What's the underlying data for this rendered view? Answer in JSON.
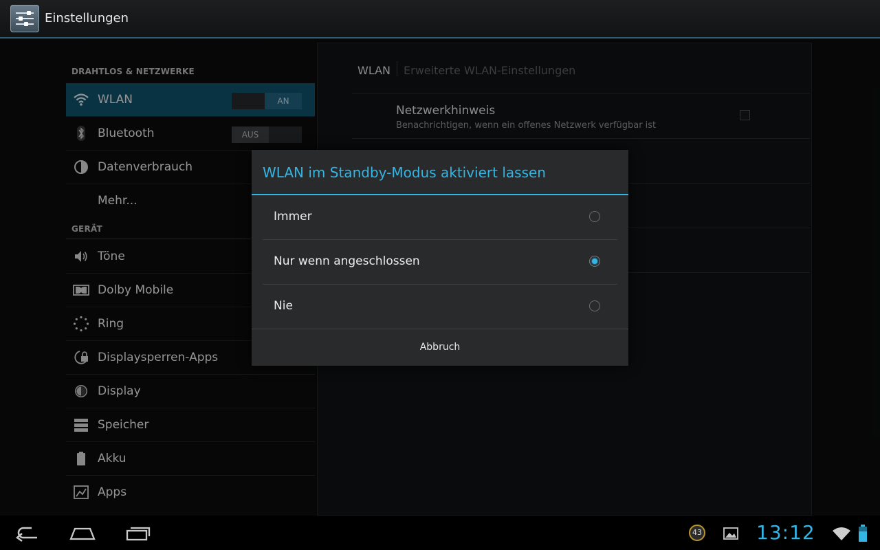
{
  "actionbar": {
    "title": "Einstellungen",
    "icon": "settings-sliders-icon"
  },
  "settings": {
    "wireless_header": "DRAHTLOS & NETZWERKE",
    "device_header": "GERÄT",
    "items": [
      {
        "label": "WLAN",
        "icon": "wifi-icon",
        "toggle": "AN",
        "selected": true
      },
      {
        "label": "Bluetooth",
        "icon": "bluetooth-icon",
        "toggle": "AUS"
      },
      {
        "label": "Datenverbrauch",
        "icon": "data-usage-icon"
      },
      {
        "label": "Mehr...",
        "icon": ""
      },
      {
        "label": "Töne",
        "icon": "speaker-icon"
      },
      {
        "label": "Dolby Mobile",
        "icon": "dolby-icon"
      },
      {
        "label": "Ring",
        "icon": "ring-icon"
      },
      {
        "label": "Displaysperren-Apps",
        "icon": "lock-apps-icon"
      },
      {
        "label": "Display",
        "icon": "brightness-icon"
      },
      {
        "label": "Speicher",
        "icon": "storage-icon"
      },
      {
        "label": "Akku",
        "icon": "battery-icon"
      },
      {
        "label": "Apps",
        "icon": "apps-icon"
      }
    ]
  },
  "wifi_panel": {
    "tab_primary": "WLAN",
    "tab_secondary": "Erweiterte WLAN-Einstellungen",
    "network_notice_title": "Netzwerkhinweis",
    "network_notice_summary": "Benachrichtigen, wenn ein offenes Netzwerk verfügbar ist"
  },
  "dialog": {
    "title": "WLAN im Standby-Modus aktiviert lassen",
    "options": [
      {
        "label": "Immer",
        "selected": false
      },
      {
        "label": "Nur wenn angeschlossen",
        "selected": true
      },
      {
        "label": "Nie",
        "selected": false
      }
    ],
    "cancel_label": "Abbruch"
  },
  "system_bar": {
    "clock": "13:12",
    "notification_count": "43",
    "icons": [
      "back-icon",
      "home-icon",
      "recent-apps-icon",
      "gallery-notification-icon",
      "wifi-signal-icon",
      "battery-status-icon"
    ]
  },
  "colors": {
    "accent": "#33b5e5",
    "selected_bg": "#0f4d66"
  }
}
